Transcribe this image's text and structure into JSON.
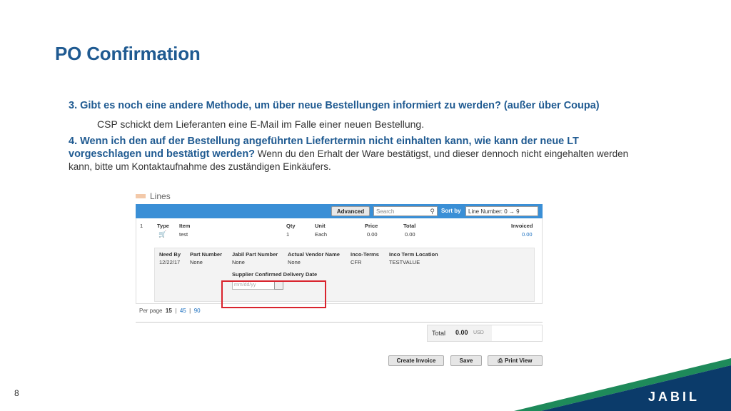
{
  "slide": {
    "title": "PO Confirmation",
    "page_number": "8",
    "logo": "JABIL"
  },
  "faq": {
    "q3": "3.  Gibt es noch eine andere Methode, um über neue Bestellungen informiert zu werden? (außer über Coupa)",
    "a3": "CSP schickt dem Lieferanten eine E-Mail im Falle einer neuen Bestellung.",
    "q4_bold_1": "4.  Wenn ich den auf der Bestellung angeführten Liefertermin nicht einhalten kann, wie kann der neue LT",
    "q4_bold_2": "vorgeschlagen und bestätigt werden?",
    "a4_inline": " Wenn du den Erhalt der Ware bestätigst, und dieser dennoch nicht eingehalten werden",
    "a4_cont": "kann, bitte um Kontaktaufnahme des zuständigen Einkäufers."
  },
  "lines": {
    "section_title": "Lines",
    "toolbar": {
      "advanced_label": "Advanced",
      "search_placeholder": "Search",
      "sort_label": "Sort by",
      "sort_value": "Line Number: 0 → 9"
    },
    "headers": {
      "type": "Type",
      "item": "Item",
      "qty": "Qty",
      "unit": "Unit",
      "price": "Price",
      "total": "Total",
      "invoiced": "Invoiced"
    },
    "row": {
      "line_no": "1",
      "item": "test",
      "qty": "1",
      "unit": "Each",
      "price": "0.00",
      "total": "0.00",
      "invoiced": "0.00"
    },
    "detail_headers": {
      "need_by": "Need By",
      "part_number": "Part Number",
      "jabil_part_number": "Jabil Part Number",
      "actual_vendor_name": "Actual Vendor Name",
      "inco_terms": "Inco-Terms",
      "inco_term_location": "Inco Term Location"
    },
    "detail_values": {
      "need_by": "12/22/17",
      "part_number": "None",
      "jabil_part_number": "None",
      "actual_vendor_name": "None",
      "inco_terms": "CFR",
      "inco_term_location": "TESTVALUE"
    },
    "supplier_date_label": "Supplier Confirmed Delivery Date",
    "supplier_date_placeholder": "mm/dd/yy",
    "per_page": {
      "label": "Per page",
      "current": "15",
      "sep1": "|",
      "opt2": "45",
      "sep2": "|",
      "opt3": "90"
    }
  },
  "totals": {
    "label": "Total",
    "value": "0.00",
    "currency": "USD"
  },
  "actions": {
    "create_invoice": "Create Invoice",
    "save": "Save",
    "print_view": "Print View"
  },
  "colors": {
    "title_blue": "#1f5a91",
    "toolbar_blue": "#3a8fd6",
    "highlight_red": "#d9232d",
    "band_green": "#1e8a5a",
    "band_navy": "#0b3b6a"
  }
}
